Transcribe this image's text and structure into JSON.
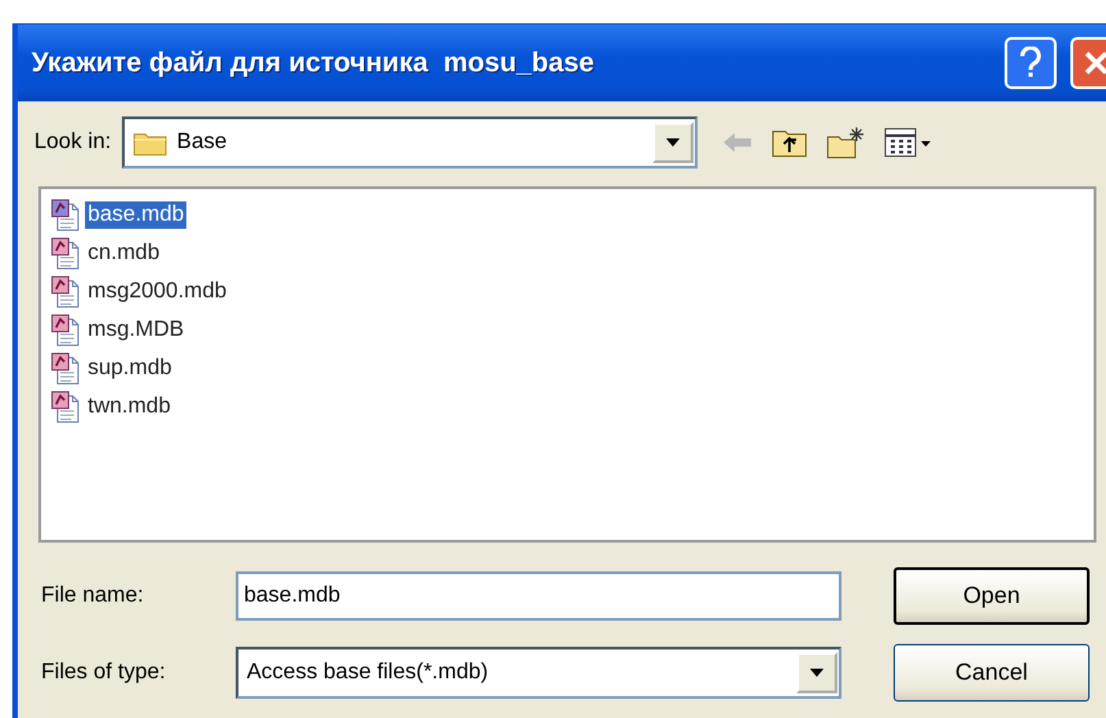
{
  "window": {
    "title": "Укажите файл для источника  mosu_base"
  },
  "look_in": {
    "label": "Look in:",
    "value": "Base"
  },
  "files": [
    {
      "name": "base.mdb",
      "selected": true
    },
    {
      "name": "cn.mdb",
      "selected": false
    },
    {
      "name": "msg2000.mdb",
      "selected": false
    },
    {
      "name": "msg.MDB",
      "selected": false
    },
    {
      "name": "sup.mdb",
      "selected": false
    },
    {
      "name": "twn.mdb",
      "selected": false
    }
  ],
  "file_name": {
    "label": "File name:",
    "value": "base.mdb"
  },
  "file_type": {
    "label": "Files of type:",
    "value": "Access base files(*.mdb)"
  },
  "buttons": [
    {
      "label": "Open",
      "kind": "default"
    },
    {
      "label": "Cancel",
      "kind": "normal"
    }
  ]
}
